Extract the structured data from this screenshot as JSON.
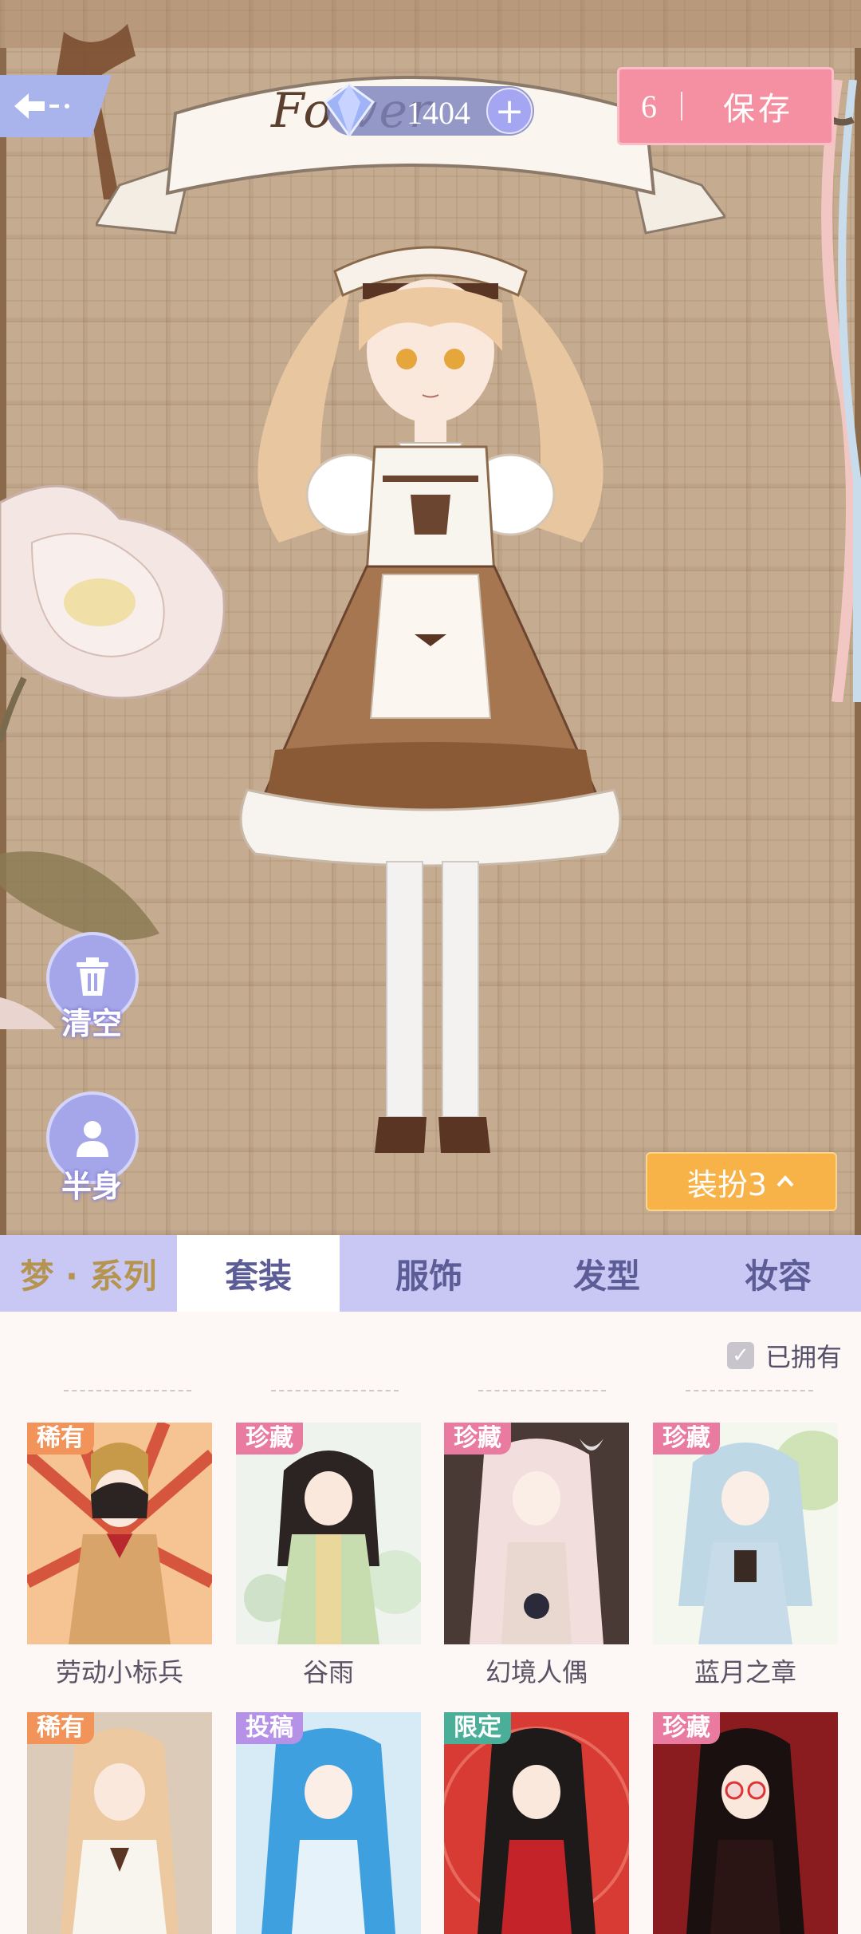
{
  "header": {
    "banner_title": "Fo  ver",
    "currency": {
      "amount": "1404",
      "icon": "diamond-icon"
    },
    "save": {
      "count": "6",
      "label": "保存"
    }
  },
  "side_buttons": {
    "clear_label": "清空",
    "half_body_label": "半身"
  },
  "outfit_button": {
    "label": "装扮3"
  },
  "tabs": [
    {
      "label": "梦 · 系列"
    },
    {
      "label": "套装"
    },
    {
      "label": "服饰"
    },
    {
      "label": "发型"
    },
    {
      "label": "妆容"
    }
  ],
  "filter": {
    "owned_label": "已拥有",
    "checked": true
  },
  "items": [
    {
      "badge": "稀有",
      "name": "劳动小标兵"
    },
    {
      "badge": "珍藏",
      "name": "谷雨"
    },
    {
      "badge": "珍藏",
      "name": "幻境人偶"
    },
    {
      "badge": "珍藏",
      "name": "蓝月之章"
    },
    {
      "badge": "稀有",
      "name": ""
    },
    {
      "badge": "投稿",
      "name": ""
    },
    {
      "badge": "限定",
      "name": ""
    },
    {
      "badge": "珍藏",
      "name": ""
    }
  ],
  "colors": {
    "accent_purple": "#a5a6ea",
    "save_pink": "#f490a1",
    "outfit_orange": "#f8b348",
    "series_gold": "#b5944f"
  }
}
